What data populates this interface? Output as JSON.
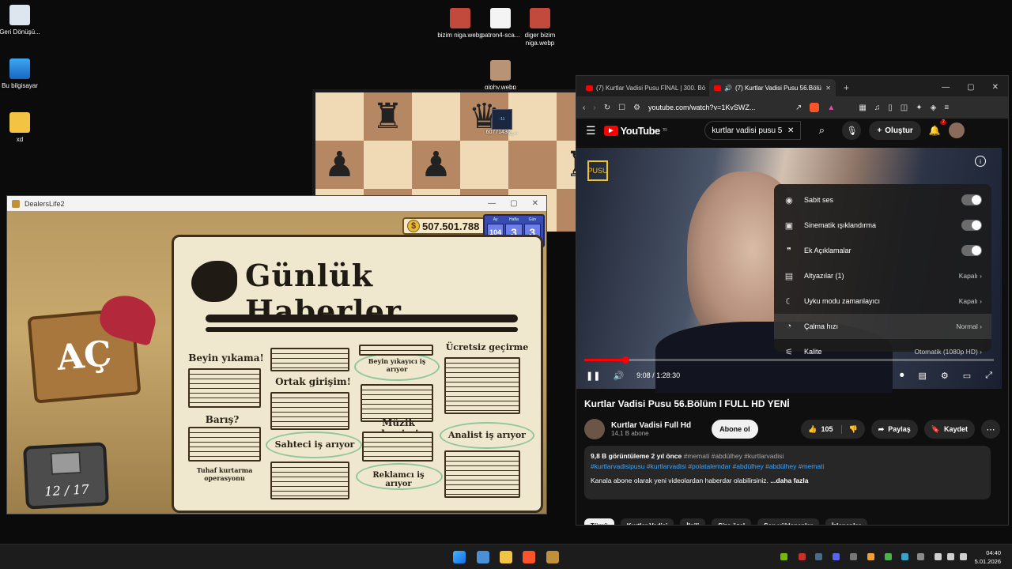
{
  "desktop": {
    "icons": [
      {
        "label": "Geri Dönüşü...",
        "icon": "recycle-bin-icon"
      },
      {
        "label": "Bu bilgisayar",
        "icon": "computer-icon"
      },
      {
        "label": "xd",
        "icon": "folder-icon"
      },
      {
        "label": "bizim niga.webp",
        "icon": "image-file-icon"
      },
      {
        "label": "patron4-sca...",
        "icon": "image-file-icon"
      },
      {
        "label": "diger bizim niga.webp",
        "icon": "image-file-icon"
      },
      {
        "label": "giphy.webp",
        "icon": "image-file-icon"
      },
      {
        "label": "60771430_...",
        "icon": "image-file-icon"
      }
    ],
    "chess_move_badge": "-11"
  },
  "game": {
    "window_title": "DealersLife2",
    "money": "507.501.788",
    "calendar": {
      "heads": [
        "Ay",
        "Hafta",
        "Gün"
      ],
      "values": [
        "104",
        "3",
        "3"
      ]
    },
    "open_sign": "AÇ",
    "counter": "12 / 17",
    "newspaper": {
      "title": "Günlük Haberler",
      "headlines": [
        "Beyin yıkama!",
        "Ortak girişim!",
        "Beyin yıkayıcı iş arıyor",
        "Ücretsiz geçirme",
        "Barış?",
        "Müzik devrimi",
        "Sahteci iş arıyor",
        "Analist iş arıyor",
        "Tuhaf kurtarma operasyonu",
        "Reklamcı iş arıyor"
      ]
    }
  },
  "browser": {
    "tabs": [
      {
        "label": "(7) Kurtlar Vadisi Pusu FİNAL | 300. Bö"
      },
      {
        "label": "(7) Kurtlar Vadisi Pusu 56.Bölü"
      }
    ],
    "url": "youtube.com/watch?v=1KvSWZ...",
    "youtube": {
      "logo": "YouTube",
      "logo_sup": "TR",
      "search_value": "kurtlar vadisi pusu 5",
      "create_label": "Oluştur",
      "notif_count": "7",
      "channel_logo": "PUSU",
      "settings": [
        {
          "label": "Sabit ses",
          "value": ""
        },
        {
          "label": "Sinematik ışıklandırma",
          "value": ""
        },
        {
          "label": "Ek Açıklamalar",
          "value": ""
        },
        {
          "label": "Altyazılar (1)",
          "value": "Kapalı"
        },
        {
          "label": "Uyku modu zamanlayıcı",
          "value": "Kapalı"
        },
        {
          "label": "Çalma hızı",
          "value": "Normal"
        },
        {
          "label": "Kalite",
          "value": "Otomatik (1080p HD)"
        }
      ],
      "time": "9:08 / 1:28:30",
      "progress": 0.103,
      "video_title": "Kurtlar Vadisi Pusu 56.Bölüm l FULL HD YENİ",
      "channel_name": "Kurtlar Vadisi Full Hd",
      "subscribers": "14,1 B abone",
      "subscribe_label": "Abone ol",
      "likes": "105",
      "share_label": "Paylaş",
      "save_label": "Kaydet",
      "desc_stats": "9,8 B görüntüleme  2 yıl önce",
      "desc_tags_inline": "#memati #abdülhey #kurtlarvadisi",
      "desc_tags_line": "#kurtlarvadisipusu #kurtlarvadisi #polatalemdar #abdülhey #abdülhey #memati",
      "desc_text": "Kanala abone olarak yeni videolardan haberdar olabilirsiniz.",
      "desc_more": "...daha fazla",
      "chips": [
        "Tümü",
        "Kurtlar Vadisi",
        "İlgili",
        "Size özel",
        "Son yüklenenler",
        "İzlenenler"
      ]
    }
  },
  "taskbar": {
    "time": "04:40",
    "date": "5.01.2026"
  }
}
